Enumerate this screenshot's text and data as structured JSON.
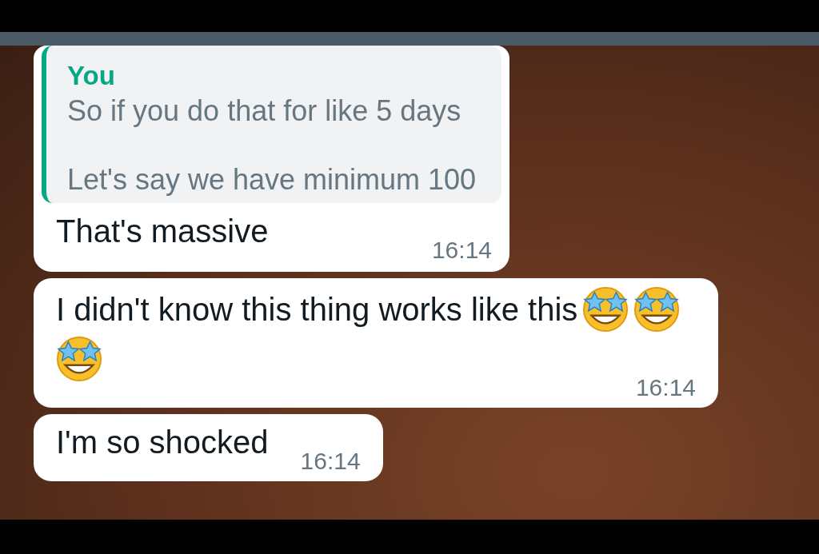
{
  "messages": [
    {
      "quote": {
        "author": "You",
        "text": "So if you do that for like 5 days\n\nLet's say we have minimum 100"
      },
      "text": "That's massive",
      "time": "16:14"
    },
    {
      "text": "I didn't know this thing works like this",
      "time": "16:14",
      "emojis": [
        {
          "kind": "star-struck"
        },
        {
          "kind": "star-struck"
        },
        {
          "kind": "star-struck"
        }
      ]
    },
    {
      "text": "I'm so shocked",
      "time": "16:14"
    }
  ]
}
